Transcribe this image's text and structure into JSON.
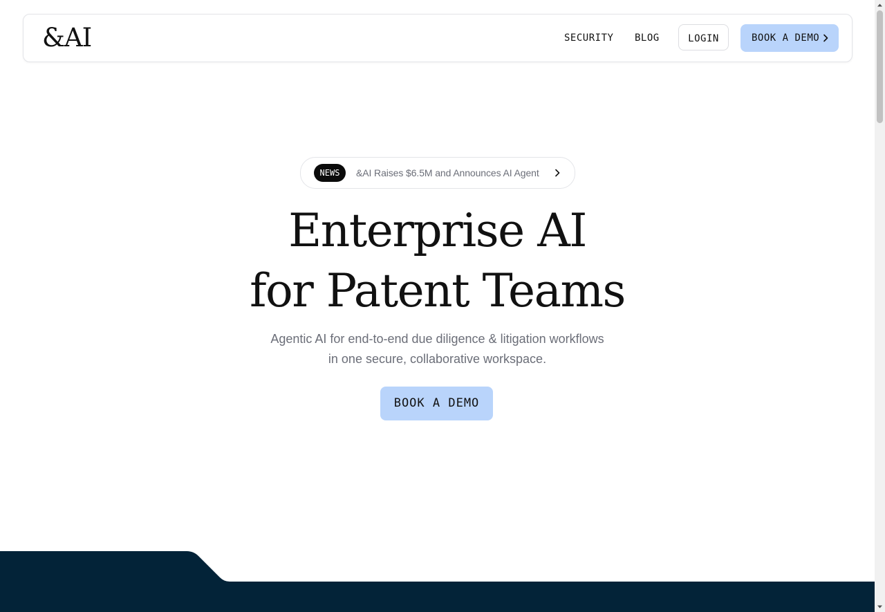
{
  "nav": {
    "logo": "&AI",
    "links": [
      {
        "label": "SECURITY"
      },
      {
        "label": "BLOG"
      }
    ],
    "login_label": "LOGIN",
    "demo_label": "BOOK A DEMO"
  },
  "news": {
    "badge": "NEWS",
    "text": "&AI Raises $6.5M and Announces AI Agent"
  },
  "hero": {
    "title_line1": "Enterprise AI",
    "title_line2": "for Patent Teams",
    "subtitle_line1": "Agentic AI for end-to-end due diligence & litigation workflows",
    "subtitle_line2": "in one secure, collaborative workspace.",
    "cta_label": "BOOK A DEMO"
  },
  "colors": {
    "accent": "#b9d4fb",
    "dark_navy": "#032338",
    "text_muted": "#6b6e78"
  },
  "icons": {
    "nav_demo": "chevron-right-icon",
    "news": "chevron-right-icon"
  }
}
